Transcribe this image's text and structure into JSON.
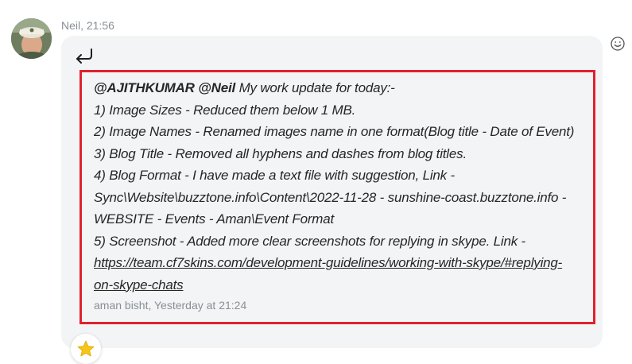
{
  "message": {
    "sender": "Neil",
    "time": "21:56",
    "header": "Neil, 21:56"
  },
  "quote": {
    "mentions": "@AJITHKUMAR @Neil",
    "intro": " My work update for today:-",
    "lines": [
      "1) Image Sizes - Reduced them below 1 MB.",
      "2) Image Names - Renamed images name in one format(Blog title - Date of Event)",
      "3) Blog Title - Removed all hyphens and dashes from blog titles.",
      "4) Blog Format - I have made a text file with suggestion, Link -",
      "Sync\\Website\\buzztone.info\\Content\\2022-11-28 - sunshine-coast.buzztone.info -",
      "WEBSITE - Events - Aman\\Event Format",
      "5) Screenshot - Added more clear screenshots for replying in skype. Link -"
    ],
    "link_line1": "https://team.cf7skins.com/development-guidelines/working-with-skype/#replying-",
    "link_line2": "on-skype-chats",
    "attribution": "aman bisht, Yesterday at 21:24"
  },
  "icons": {
    "reply": "reply-arrow-icon",
    "emoji": "smiley-icon",
    "reaction": "star-icon"
  },
  "colors": {
    "highlight_border": "#e0222e",
    "bubble_bg": "#f2f4f6",
    "star": "#f5c518"
  }
}
